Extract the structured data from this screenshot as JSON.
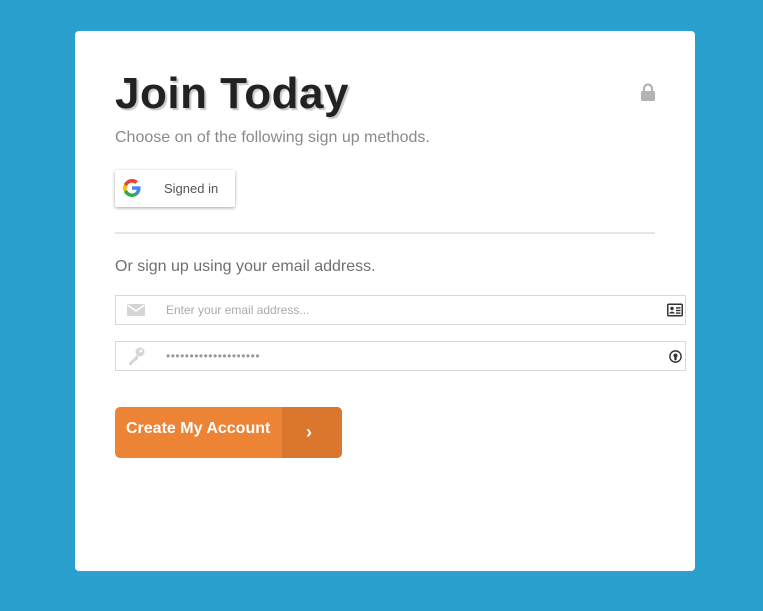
{
  "form": {
    "title": "Join Today",
    "subtitle": "Choose on of the following sign up methods.",
    "lock_icon": "lock-icon",
    "google_button": {
      "icon": "google-logo-icon",
      "label": "Signed in"
    },
    "email_prompt": "Or sign up using your email address.",
    "email_field": {
      "icon": "envelope-icon",
      "placeholder": "Enter your email address...",
      "value": "",
      "trailing_icon": "contact-card-icon"
    },
    "password_field": {
      "icon": "key-icon",
      "value": "••••••••••••••••••••",
      "trailing_icon": "password-reveal-icon"
    },
    "submit_button": {
      "label": "Create My Account",
      "arrow": "›",
      "icon": "chevron-right-icon"
    }
  },
  "colors": {
    "background": "#2aa0cf",
    "card": "#ffffff",
    "accent": "#ed8334",
    "accent_dark": "#db762f"
  }
}
